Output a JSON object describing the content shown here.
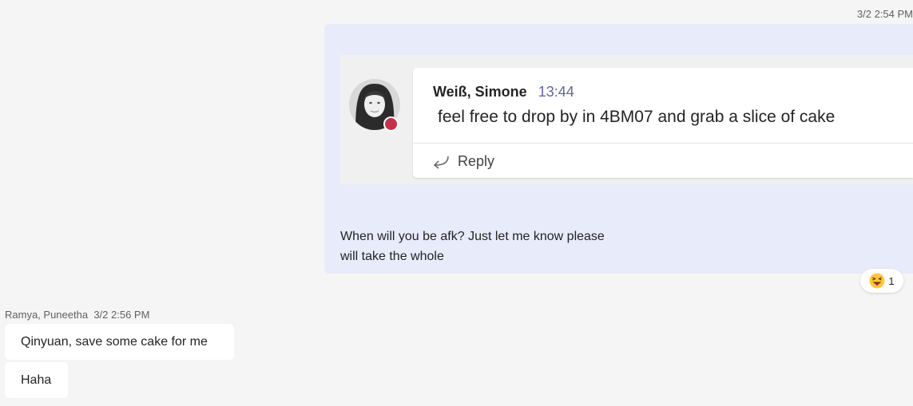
{
  "thread": {
    "my_message": {
      "timestamp": "3/2 2:54 PM",
      "quoted": {
        "author": "Weiß, Simone",
        "time": "13:44",
        "text": "feel free to drop by in 4BM07 and grab a slice of cake",
        "reply_label": "Reply",
        "status_color": "#c4314b"
      },
      "lines": [
        "When will you be afk? Just let me know please",
        "will take the whole"
      ],
      "reaction": {
        "emoji": "squinting-tongue-face",
        "count": "1"
      }
    },
    "other_message": {
      "author": "Ramya, Puneetha",
      "timestamp": "3/2 2:56 PM",
      "bubbles": [
        "Qinyuan, save some cake for me",
        "Haha"
      ]
    }
  },
  "colors": {
    "background": "#f5f5f5",
    "my_bubble": "#e8ebfa",
    "accent": "#6264a7"
  }
}
